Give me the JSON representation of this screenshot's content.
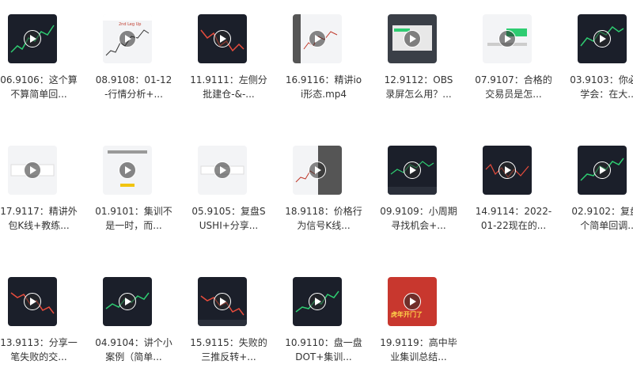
{
  "files": [
    {
      "name": "06.9106：这个算不算简单回..."
    },
    {
      "name": "08.9108：01-12-行情分析+..."
    },
    {
      "name": "11.9111：左侧分批建仓-&-..."
    },
    {
      "name": "16.9116：精讲ioi形态.mp4"
    },
    {
      "name": "12.9112：OBS录屏怎么用？..."
    },
    {
      "name": "07.9107：合格的交易员是怎..."
    },
    {
      "name": "03.9103：你必须学会：在大..."
    },
    {
      "name": "17.9117：精讲外包K线+教练..."
    },
    {
      "name": "01.9101：集训不是一时，而..."
    },
    {
      "name": "05.9105：复盘SUSHI+分享..."
    },
    {
      "name": "18.9118：价格行为信号K线..."
    },
    {
      "name": "09.9109：小周期寻找机会+..."
    },
    {
      "name": "14.9114：2022-01-22现在的..."
    },
    {
      "name": "02.9102：复盘2个简单回调..."
    },
    {
      "name": "13.9113：分享一笔失败的交..."
    },
    {
      "name": "04.9104：讲个小案例（简单..."
    },
    {
      "name": "15.9115：失败的三推反转+..."
    },
    {
      "name": "10.9110：盘一盘DOT+集训..."
    },
    {
      "name": "19.9119：高中毕业集训总结..."
    }
  ],
  "thumb_texts": {
    "t1": "2nd Leg Up",
    "t18": "虎年开门了"
  },
  "icons": {
    "play": "play-icon"
  }
}
